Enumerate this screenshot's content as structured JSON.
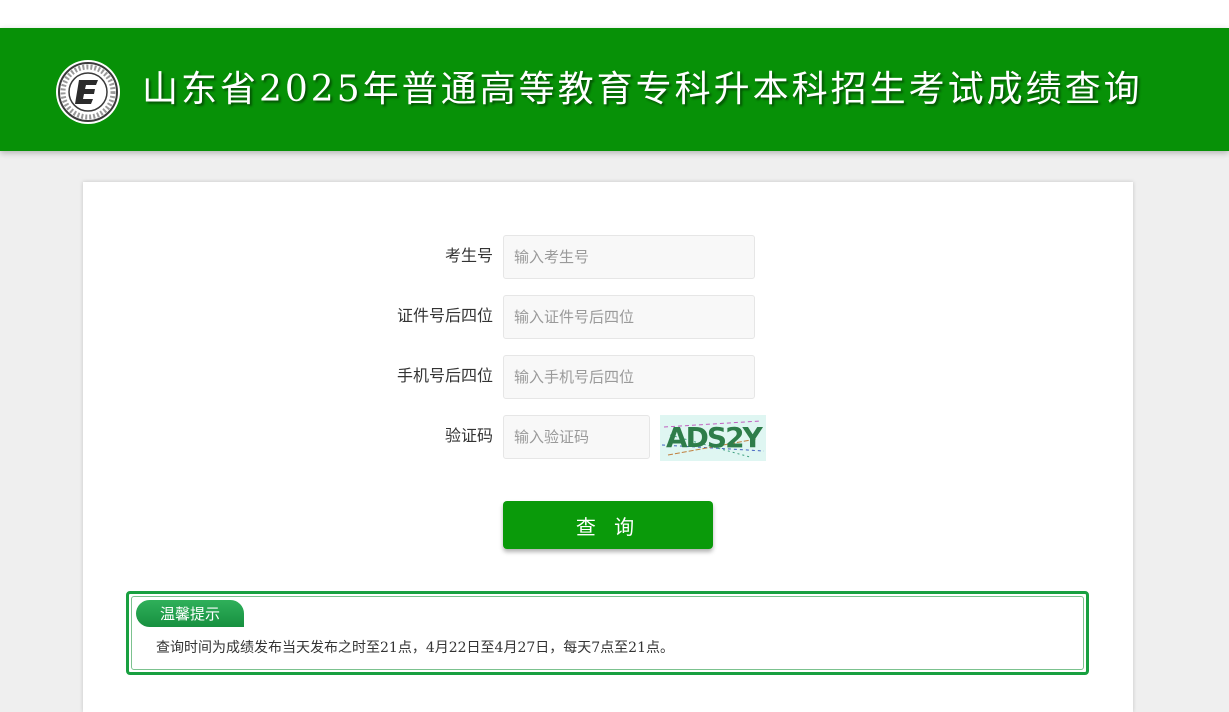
{
  "header": {
    "title": "山东省2025年普通高等教育专科升本科招生考试成绩查询",
    "logo_icon": "exam-emblem-icon"
  },
  "form": {
    "fields": [
      {
        "label": "考生号",
        "placeholder": "输入考生号",
        "value": ""
      },
      {
        "label": "证件号后四位",
        "placeholder": "输入证件号后四位",
        "value": ""
      },
      {
        "label": "手机号后四位",
        "placeholder": "输入手机号后四位",
        "value": ""
      },
      {
        "label": "验证码",
        "placeholder": "输入验证码",
        "value": ""
      }
    ],
    "captcha_text": "ADS2Y",
    "submit_label": "查 询"
  },
  "tips": {
    "title": "温馨提示",
    "text": "查询时间为成绩发布当天发布之时至21点，4月22日至4月27日，每天7点至21点。"
  },
  "colors": {
    "brand_green": "#079107",
    "button_green": "#0a9a0a",
    "tip_border": "#18a040",
    "page_bg": "#efefef"
  }
}
